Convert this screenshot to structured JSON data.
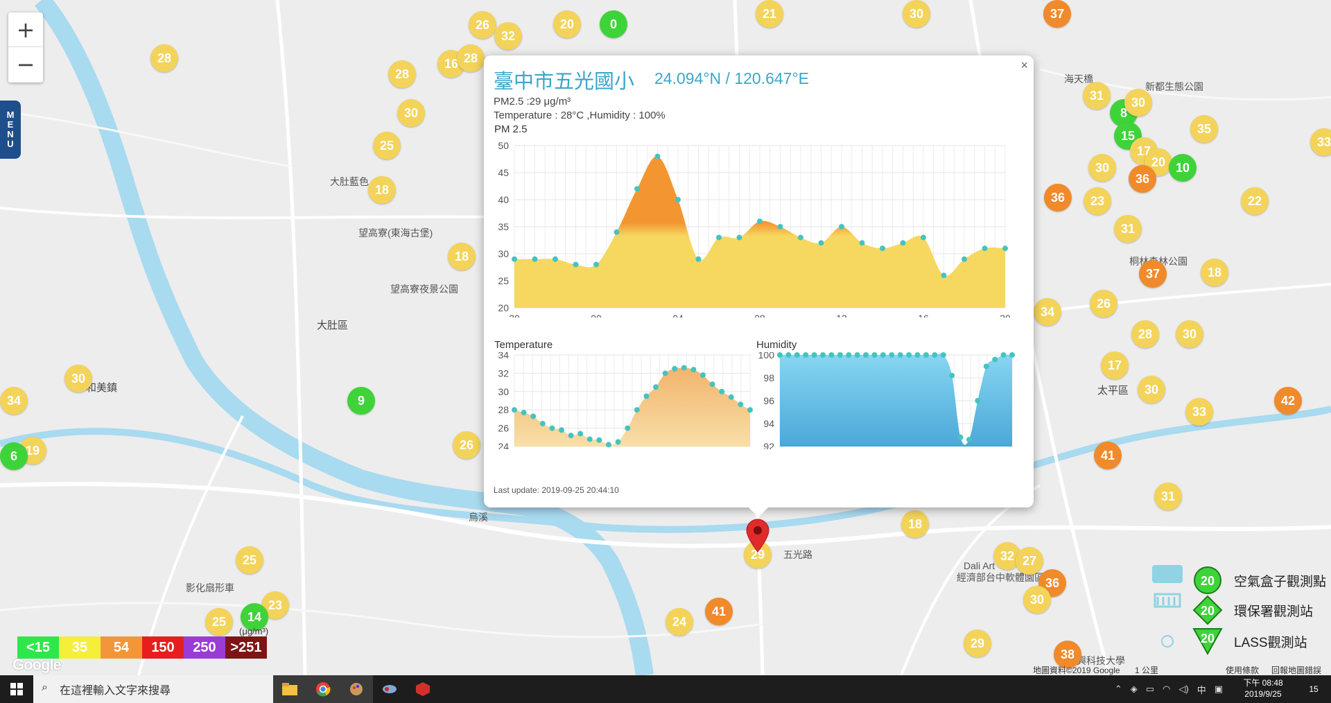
{
  "map": {
    "places": [
      {
        "name": "大肚區",
        "cls": "big",
        "l": 457,
        "t": 458
      },
      {
        "name": "和美鎮",
        "cls": "big",
        "l": 124,
        "t": 548
      },
      {
        "name": "太平區",
        "cls": "big",
        "l": 1583,
        "t": 552
      },
      {
        "name": "大肚藍色",
        "cls": "",
        "l": 476,
        "t": 252
      },
      {
        "name": "望高寮(東海古堡)",
        "cls": "",
        "l": 517,
        "t": 326
      },
      {
        "name": "望高寮夜景公園",
        "cls": "",
        "l": 563,
        "t": 407
      },
      {
        "name": "新都生態公園",
        "cls": "",
        "l": 1652,
        "t": 115
      },
      {
        "name": "海天橋",
        "cls": "",
        "l": 1535,
        "t": 104
      },
      {
        "name": "桐林森林公園",
        "cls": "",
        "l": 1629,
        "t": 367
      },
      {
        "name": "影化扇形車",
        "cls": "",
        "l": 268,
        "t": 838
      },
      {
        "name": "經濟部台中軟體園區",
        "cls": "",
        "l": 1380,
        "t": 823
      },
      {
        "name": "Dali Art",
        "cls": "",
        "l": 1390,
        "t": 808
      },
      {
        "name": "烏溪",
        "cls": "",
        "l": 676,
        "t": 736
      },
      {
        "name": "五光路",
        "cls": "",
        "l": 1130,
        "t": 790
      },
      {
        "name": "興科技大學",
        "cls": "",
        "l": 1553,
        "t": 943
      }
    ],
    "markers": [
      {
        "v": "28",
        "c": "y",
        "l": 217,
        "t": 64
      },
      {
        "v": "26",
        "c": "y",
        "l": 676,
        "t": 16
      },
      {
        "v": "32",
        "c": "y",
        "l": 713,
        "t": 32
      },
      {
        "v": "20",
        "c": "y",
        "l": 798,
        "t": 15
      },
      {
        "v": "0",
        "c": "g",
        "l": 865,
        "t": 15
      },
      {
        "v": "21",
        "c": "y",
        "l": 1090,
        "t": 0
      },
      {
        "v": "30",
        "c": "y",
        "l": 1302,
        "t": 0
      },
      {
        "v": "37",
        "c": "o",
        "l": 1505,
        "t": 0
      },
      {
        "v": "16",
        "c": "y",
        "l": 631,
        "t": 72
      },
      {
        "v": "28",
        "c": "y",
        "l": 659,
        "t": 64
      },
      {
        "v": "28",
        "c": "y",
        "l": 560,
        "t": 87
      },
      {
        "v": "30",
        "c": "y",
        "l": 573,
        "t": 143
      },
      {
        "v": "25",
        "c": "y",
        "l": 538,
        "t": 190
      },
      {
        "v": "18",
        "c": "y",
        "l": 531,
        "t": 254
      },
      {
        "v": "18",
        "c": "y",
        "l": 646,
        "t": 350
      },
      {
        "v": "30",
        "c": "y",
        "l": 93,
        "t": 526
      },
      {
        "v": "34",
        "c": "y",
        "l": 0,
        "t": 558
      },
      {
        "v": "19",
        "c": "y",
        "l": 27,
        "t": 630
      },
      {
        "v": "6",
        "c": "g",
        "l": 0,
        "t": 638
      },
      {
        "v": "9",
        "c": "g",
        "l": 501,
        "t": 558
      },
      {
        "v": "26",
        "c": "y",
        "l": 653,
        "t": 622
      },
      {
        "v": "25",
        "c": "y",
        "l": 340,
        "t": 788
      },
      {
        "v": "23",
        "c": "y",
        "l": 377,
        "t": 853
      },
      {
        "v": "25",
        "c": "y",
        "l": 296,
        "t": 877
      },
      {
        "v": "14",
        "c": "g",
        "l": 347,
        "t": 870
      },
      {
        "v": "24",
        "c": "y",
        "l": 960,
        "t": 877
      },
      {
        "v": "41",
        "c": "o",
        "l": 1017,
        "t": 862
      },
      {
        "v": "29",
        "c": "y",
        "l": 1073,
        "t": 780
      },
      {
        "v": "31",
        "c": "y",
        "l": 1562,
        "t": 118
      },
      {
        "v": "8",
        "c": "g",
        "l": 1601,
        "t": 143
      },
      {
        "v": "30",
        "c": "y",
        "l": 1622,
        "t": 128
      },
      {
        "v": "15",
        "c": "g",
        "l": 1607,
        "t": 176
      },
      {
        "v": "17",
        "c": "y",
        "l": 1630,
        "t": 198
      },
      {
        "v": "20",
        "c": "y",
        "l": 1651,
        "t": 214
      },
      {
        "v": "36",
        "c": "o",
        "l": 1628,
        "t": 238
      },
      {
        "v": "10",
        "c": "g",
        "l": 1686,
        "t": 222
      },
      {
        "v": "35",
        "c": "y",
        "l": 1717,
        "t": 166
      },
      {
        "v": "30",
        "c": "y",
        "l": 1570,
        "t": 222
      },
      {
        "v": "23",
        "c": "y",
        "l": 1563,
        "t": 270
      },
      {
        "v": "36",
        "c": "o",
        "l": 1506,
        "t": 265
      },
      {
        "v": "31",
        "c": "y",
        "l": 1607,
        "t": 310
      },
      {
        "v": "22",
        "c": "y",
        "l": 1790,
        "t": 270
      },
      {
        "v": "37",
        "c": "o",
        "l": 1643,
        "t": 375
      },
      {
        "v": "18",
        "c": "y",
        "l": 1732,
        "t": 373
      },
      {
        "v": "26",
        "c": "y",
        "l": 1572,
        "t": 418
      },
      {
        "v": "34",
        "c": "y",
        "l": 1491,
        "t": 430
      },
      {
        "v": "28",
        "c": "y",
        "l": 1632,
        "t": 462
      },
      {
        "v": "30",
        "c": "y",
        "l": 1696,
        "t": 462
      },
      {
        "v": "17",
        "c": "y",
        "l": 1588,
        "t": 507
      },
      {
        "v": "30",
        "c": "y",
        "l": 1641,
        "t": 542
      },
      {
        "v": "33",
        "c": "y",
        "l": 1710,
        "t": 574
      },
      {
        "v": "42",
        "c": "o",
        "l": 1838,
        "t": 558
      },
      {
        "v": "41",
        "c": "o",
        "l": 1578,
        "t": 637
      },
      {
        "v": "31",
        "c": "y",
        "l": 1665,
        "t": 696
      },
      {
        "v": "18",
        "c": "y",
        "l": 1300,
        "t": 736
      },
      {
        "v": "32",
        "c": "y",
        "l": 1433,
        "t": 782
      },
      {
        "v": "27",
        "c": "y",
        "l": 1465,
        "t": 789
      },
      {
        "v": "36",
        "c": "o",
        "l": 1498,
        "t": 821
      },
      {
        "v": "30",
        "c": "y",
        "l": 1476,
        "t": 845
      },
      {
        "v": "29",
        "c": "y",
        "l": 1390,
        "t": 908
      },
      {
        "v": "38",
        "c": "o",
        "l": 1520,
        "t": 924
      },
      {
        "v": "33",
        "c": "y",
        "l": 1890,
        "t": 185
      }
    ]
  },
  "zoom": {
    "plus": "+",
    "minus": "−"
  },
  "menu": [
    "M",
    "E",
    "N",
    "U"
  ],
  "popup": {
    "close": "×",
    "title": "臺中市五光國小",
    "coord": "24.094°N / 120.647°E",
    "pm_line": "PM2.5 :29 μg/m³",
    "temp_line": "Temperature : 28°C ,Humidity : 100%",
    "pm_title": "PM 2.5",
    "temp_title": "Temperature",
    "hum_title": "Humidity",
    "last_update": "Last update: 2019-09-25 20:44:10"
  },
  "chart_data": [
    {
      "type": "area",
      "title": "PM 2.5",
      "x": [
        "20",
        "21",
        "22",
        "23",
        "00",
        "01",
        "02",
        "03",
        "04",
        "05",
        "06",
        "07",
        "08",
        "09",
        "10",
        "11",
        "12",
        "13",
        "14",
        "15",
        "16",
        "17",
        "18",
        "19",
        "20"
      ],
      "values": [
        29,
        29,
        29,
        28,
        28,
        34,
        42,
        48,
        40,
        29,
        33,
        33,
        36,
        35,
        33,
        32,
        35,
        32,
        31,
        32,
        33,
        26,
        29,
        31,
        31
      ],
      "ylim": [
        20,
        50
      ],
      "yticks": [
        20,
        25,
        30,
        35,
        40,
        45,
        50
      ],
      "xticks": [
        "20",
        "00",
        "04",
        "08",
        "12",
        "16",
        "20"
      ],
      "threshold": 35,
      "colors": {
        "low": "#f6d860",
        "high": "#f39632",
        "point": "#46c3c0"
      },
      "grid": true
    },
    {
      "type": "area",
      "title": "Temperature",
      "x": [
        "20",
        "20.5",
        "21",
        "21.5",
        "22",
        "22.5",
        "23",
        "23.5",
        "00",
        "00.5",
        "01",
        "01.5",
        "02",
        "02.5",
        "03",
        "03.5",
        "04",
        "04.5",
        "05",
        "05.5",
        "06",
        "06.5",
        "07",
        "07.5",
        "08",
        "08.5"
      ],
      "values": [
        28,
        27.7,
        27.3,
        26.5,
        26,
        25.8,
        25.2,
        25.4,
        24.8,
        24.7,
        24.2,
        24.5,
        26,
        28,
        29.5,
        30.5,
        32,
        32.5,
        32.6,
        32.4,
        31.8,
        30.8,
        30,
        29.4,
        28.6,
        28
      ],
      "ylim": [
        24,
        34
      ],
      "yticks": [
        24,
        26,
        28,
        30,
        32,
        34
      ],
      "colors": {
        "fill": "#f3c48a",
        "point": "#46c3c0"
      },
      "grid": true
    },
    {
      "type": "area",
      "title": "Humidity",
      "x": [
        "20",
        "20.5",
        "21",
        "21.5",
        "22",
        "22.5",
        "23",
        "23.5",
        "00",
        "00.5",
        "01",
        "01.5",
        "02",
        "02.5",
        "03",
        "03.5",
        "04",
        "04.5",
        "05",
        "05.5",
        "06",
        "06.5",
        "07",
        "07.5",
        "08",
        "08.5",
        "09",
        "09.5"
      ],
      "values": [
        100,
        100,
        100,
        100,
        100,
        100,
        100,
        100,
        100,
        100,
        100,
        100,
        100,
        100,
        100,
        100,
        100,
        100,
        100,
        100,
        98.2,
        92.8,
        92.6,
        96,
        99,
        99.6,
        100,
        100
      ],
      "ylim": [
        92,
        100
      ],
      "yticks": [
        92,
        94,
        96,
        98,
        100
      ],
      "colors": {
        "fill": "#5fc0e5",
        "point": "#46c3c0"
      },
      "grid": true
    }
  ],
  "legend": {
    "items": [
      {
        "label": "<15",
        "color": "#2ee84a"
      },
      {
        "label": "35",
        "color": "#f5ef3a"
      },
      {
        "label": "54",
        "color": "#f3963a"
      },
      {
        "label": "150",
        "color": "#e61e1e"
      },
      {
        "label": "250",
        "color": "#9a3bd6"
      },
      {
        "label": ">251",
        "color": "#7d1515"
      }
    ],
    "unit": "(μg/m³)"
  },
  "google": "Google",
  "stations": [
    {
      "value": "20",
      "label": "空氣盒子觀測點",
      "shape": "circle"
    },
    {
      "value": "20",
      "label": "環保署觀測站",
      "shape": "diamond"
    },
    {
      "value": "20",
      "label": "LASS觀測站",
      "shape": "triangle"
    }
  ],
  "attribution": {
    "data": "地圖資料©2019 Google",
    "scale": "1 公里",
    "terms": "使用條款",
    "report": "回報地圖錯誤"
  },
  "taskbar": {
    "search_placeholder": "在這裡輸入文字來搜尋",
    "time": "下午 08:48",
    "date": "2019/9/25",
    "ime": "中",
    "notif": "15"
  }
}
